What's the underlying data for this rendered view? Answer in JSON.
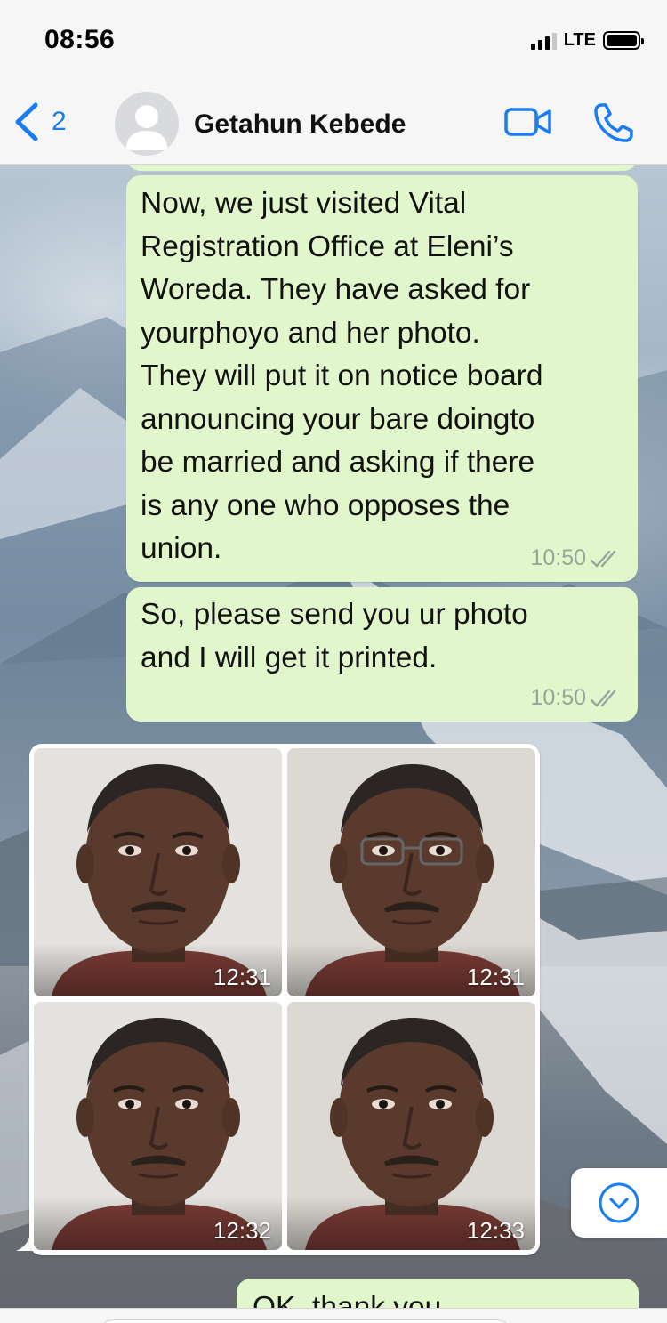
{
  "status_bar": {
    "time": "08:56",
    "network": "LTE"
  },
  "header": {
    "back_count": "2",
    "contact_name": "Getahun Kebede",
    "icons": [
      "chevron-left-icon",
      "avatar-placeholder",
      "video-camera-icon",
      "phone-icon"
    ],
    "accent_color": "#1a7cf0"
  },
  "messages": [
    {
      "text": "Now, we just visited Vital Registration Office at Eleni’s Woreda. They have asked for yourphoyo and her photo. They will put it on notice board announcing your bare doingto be married and asking if there is any one who opposes the union.",
      "lines": [
        "Now, we just visited Vital",
        "Registration Office at Eleni’s",
        "Woreda. They have asked for",
        "yourphoyo and her photo.",
        "They will put it on notice board",
        "announcing your bare doingto",
        "be married and asking if there",
        "is any one who opposes the",
        "union."
      ],
      "time": "10:50",
      "direction": "outgoing",
      "status": "read"
    },
    {
      "lines": [
        "So, please send you ur photo",
        "and I will get it printed."
      ],
      "time": "10:50",
      "direction": "outgoing",
      "status": "read"
    }
  ],
  "photo_album": {
    "direction": "incoming",
    "photos": [
      {
        "time": "12:31",
        "glasses": false
      },
      {
        "time": "12:31",
        "glasses": true
      },
      {
        "time": "12:32",
        "glasses": false
      },
      {
        "time": "12:33",
        "glasses": false
      }
    ]
  },
  "partial_message": {
    "text": "OK, thank you"
  },
  "colors": {
    "outgoing_bubble": "#e1f7cb",
    "meta_text": "#9aa59a"
  }
}
